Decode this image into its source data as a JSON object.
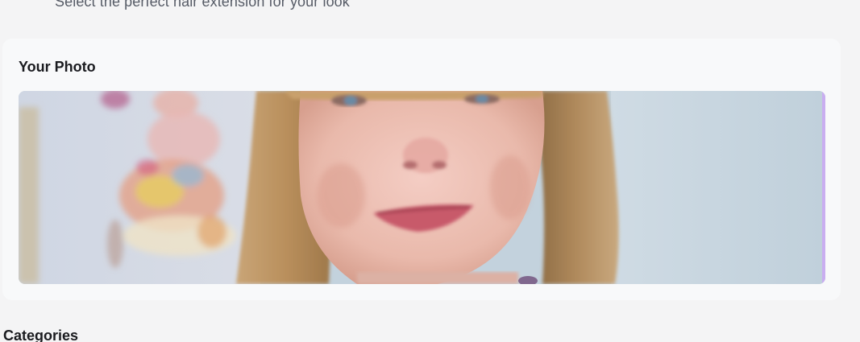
{
  "header": {
    "subtitle": "Select the perfect hair extension for your look"
  },
  "photo_card": {
    "title": "Your Photo",
    "image_description_icon": "user-portrait-photo"
  },
  "categories": {
    "title": "Categories"
  },
  "colors": {
    "page_background": "#f4f4f5",
    "card_background": "#f8f9fa",
    "accent_edge": "#c9aef0",
    "heading_text": "#1a1b1f",
    "subtitle_text": "#565b66"
  }
}
